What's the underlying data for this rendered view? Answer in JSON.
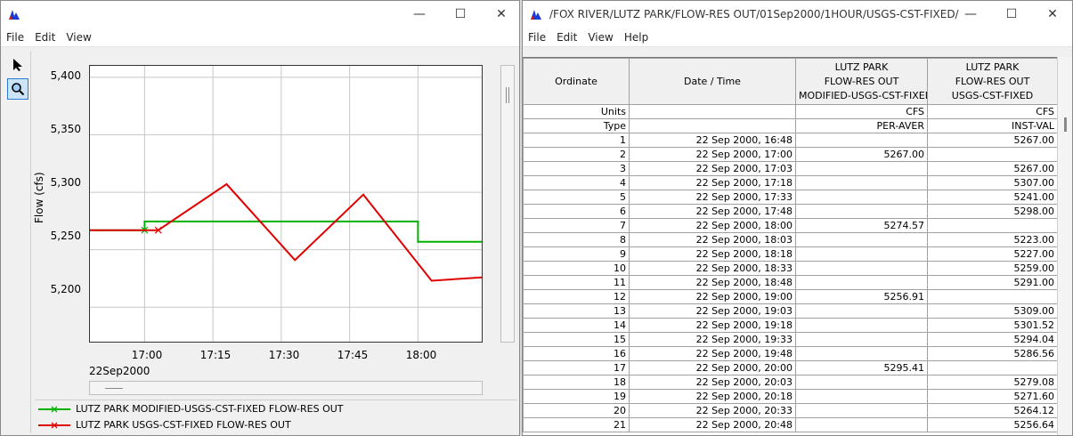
{
  "left_window": {
    "title": "",
    "menu": [
      "File",
      "Edit",
      "View"
    ],
    "ylabel": "Flow (cfs)",
    "date_label": "22Sep2000",
    "legend": [
      {
        "label": "LUTZ PARK MODIFIED-USGS-CST-FIXED FLOW-RES OUT",
        "color": "#00b000"
      },
      {
        "label": "LUTZ PARK USGS-CST-FIXED FLOW-RES OUT",
        "color": "#e00000"
      }
    ]
  },
  "right_window": {
    "title": "/FOX RIVER/LUTZ PARK/FLOW-RES OUT/01Sep2000/1HOUR/USGS-CST-FIXED/",
    "menu": [
      "File",
      "Edit",
      "View",
      "Help"
    ],
    "headers": {
      "ordinate": "Ordinate",
      "datetime": "Date / Time",
      "col1": [
        "LUTZ PARK",
        "FLOW-RES OUT",
        "MODIFIED-USGS-CST-FIXED"
      ],
      "col2": [
        "LUTZ PARK",
        "FLOW-RES OUT",
        "USGS-CST-FIXED"
      ]
    },
    "units_row": {
      "label": "Units",
      "col1": "CFS",
      "col2": "CFS"
    },
    "type_row": {
      "label": "Type",
      "col1": "PER-AVER",
      "col2": "INST-VAL"
    },
    "rows": [
      {
        "ord": "1",
        "dt": "22 Sep 2000, 16:48",
        "c1": "",
        "c2": "5267.00"
      },
      {
        "ord": "2",
        "dt": "22 Sep 2000, 17:00",
        "c1": "5267.00",
        "c2": ""
      },
      {
        "ord": "3",
        "dt": "22 Sep 2000, 17:03",
        "c1": "",
        "c2": "5267.00"
      },
      {
        "ord": "4",
        "dt": "22 Sep 2000, 17:18",
        "c1": "",
        "c2": "5307.00"
      },
      {
        "ord": "5",
        "dt": "22 Sep 2000, 17:33",
        "c1": "",
        "c2": "5241.00"
      },
      {
        "ord": "6",
        "dt": "22 Sep 2000, 17:48",
        "c1": "",
        "c2": "5298.00"
      },
      {
        "ord": "7",
        "dt": "22 Sep 2000, 18:00",
        "c1": "5274.57",
        "c2": ""
      },
      {
        "ord": "8",
        "dt": "22 Sep 2000, 18:03",
        "c1": "",
        "c2": "5223.00"
      },
      {
        "ord": "9",
        "dt": "22 Sep 2000, 18:18",
        "c1": "",
        "c2": "5227.00"
      },
      {
        "ord": "10",
        "dt": "22 Sep 2000, 18:33",
        "c1": "",
        "c2": "5259.00"
      },
      {
        "ord": "11",
        "dt": "22 Sep 2000, 18:48",
        "c1": "",
        "c2": "5291.00"
      },
      {
        "ord": "12",
        "dt": "22 Sep 2000, 19:00",
        "c1": "5256.91",
        "c2": ""
      },
      {
        "ord": "13",
        "dt": "22 Sep 2000, 19:03",
        "c1": "",
        "c2": "5309.00"
      },
      {
        "ord": "14",
        "dt": "22 Sep 2000, 19:18",
        "c1": "",
        "c2": "5301.52"
      },
      {
        "ord": "15",
        "dt": "22 Sep 2000, 19:33",
        "c1": "",
        "c2": "5294.04"
      },
      {
        "ord": "16",
        "dt": "22 Sep 2000, 19:48",
        "c1": "",
        "c2": "5286.56"
      },
      {
        "ord": "17",
        "dt": "22 Sep 2000, 20:00",
        "c1": "5295.41",
        "c2": ""
      },
      {
        "ord": "18",
        "dt": "22 Sep 2000, 20:03",
        "c1": "",
        "c2": "5279.08"
      },
      {
        "ord": "19",
        "dt": "22 Sep 2000, 20:18",
        "c1": "",
        "c2": "5271.60"
      },
      {
        "ord": "20",
        "dt": "22 Sep 2000, 20:33",
        "c1": "",
        "c2": "5264.12"
      },
      {
        "ord": "21",
        "dt": "22 Sep 2000, 20:48",
        "c1": "",
        "c2": "5256.64"
      }
    ]
  },
  "chart_data": {
    "type": "line",
    "title": "",
    "xlabel": "22Sep2000",
    "ylabel": "Flow (cfs)",
    "x_ticks": [
      "17:00",
      "17:15",
      "17:30",
      "17:45",
      "18:00"
    ],
    "y_ticks": [
      "5,200",
      "5,250",
      "5,300",
      "5,350",
      "5,400"
    ],
    "xlim": [
      "16:48",
      "18:14"
    ],
    "ylim": [
      5170,
      5410
    ],
    "grid": true,
    "legend_position": "bottom",
    "series": [
      {
        "name": "LUTZ PARK MODIFIED-USGS-CST-FIXED FLOW-RES OUT",
        "color": "#00b000",
        "step": true,
        "x": [
          "16:48",
          "17:00",
          "17:00",
          "18:00",
          "18:00",
          "18:14"
        ],
        "y": [
          5267,
          5267,
          5274.57,
          5274.57,
          5256.91,
          5256.91
        ],
        "marker_x": "17:00",
        "marker_y": 5267
      },
      {
        "name": "LUTZ PARK USGS-CST-FIXED FLOW-RES OUT",
        "color": "#e00000",
        "step": false,
        "x": [
          "16:48",
          "17:03",
          "17:18",
          "17:33",
          "17:48",
          "18:03",
          "18:14"
        ],
        "y": [
          5267,
          5267,
          5307,
          5241,
          5298,
          5223,
          5226
        ],
        "marker_x": "17:03",
        "marker_y": 5267
      }
    ]
  }
}
